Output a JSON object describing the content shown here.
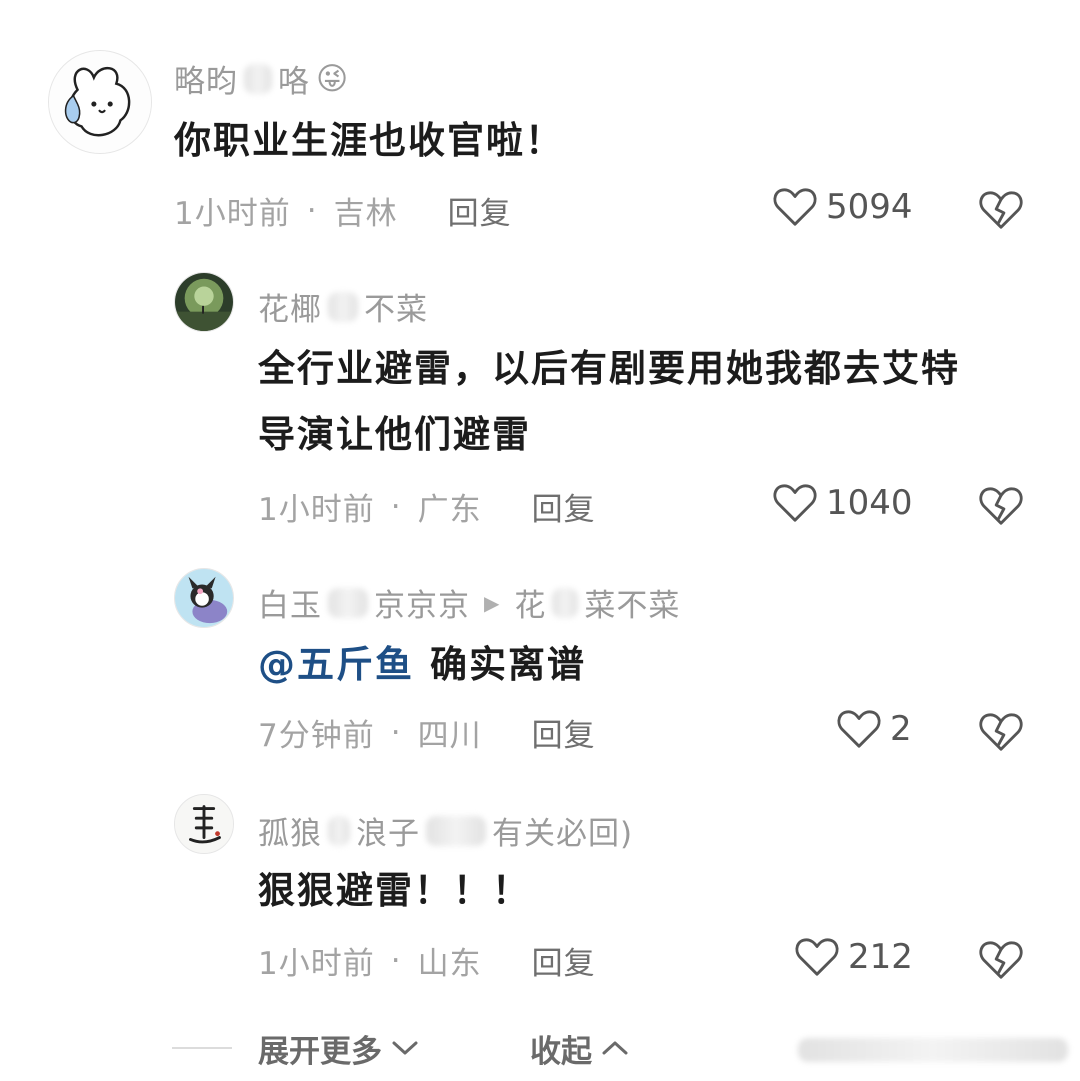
{
  "comments": [
    {
      "name_prefix": "略昀",
      "name_suffix": "咯",
      "name_emoji": "😜",
      "text": "你职业生涯也收官啦！",
      "time": "1小时前",
      "location": "吉林",
      "reply_label": "回复",
      "likes": "5094"
    },
    {
      "name_prefix": "花椰",
      "name_suffix": "不菜",
      "text_line1": "全行业避雷，以后有剧要用她我都去艾特",
      "text_line2": "导演让他们避雷",
      "time": "1小时前",
      "location": "广东",
      "reply_label": "回复",
      "likes": "1040"
    },
    {
      "name_prefix": "白玉",
      "name_suffix": "京京京",
      "reply_to_prefix": "花",
      "reply_to_suffix": "菜不菜",
      "mention": "@五斤鱼",
      "text": "确实离谱",
      "time": "7分钟前",
      "location": "四川",
      "reply_label": "回复",
      "likes": "2"
    },
    {
      "name_prefix": "孤狼",
      "name_mid": "浪子",
      "name_suffix": "有关必回)",
      "text": "狠狠避雷！！！",
      "time": "1小时前",
      "location": "山东",
      "reply_label": "回复",
      "likes": "212"
    }
  ],
  "footer": {
    "expand_label": "展开更多",
    "collapse_label": "收起"
  },
  "icons": {
    "like": "heart-outline-icon",
    "dislike": "broken-heart-icon",
    "expand": "chevron-down-icon",
    "collapse": "chevron-up-icon"
  },
  "colors": {
    "mention": "#1e4f86",
    "meta": "#a3a3a3",
    "name": "#9a9a9a"
  }
}
